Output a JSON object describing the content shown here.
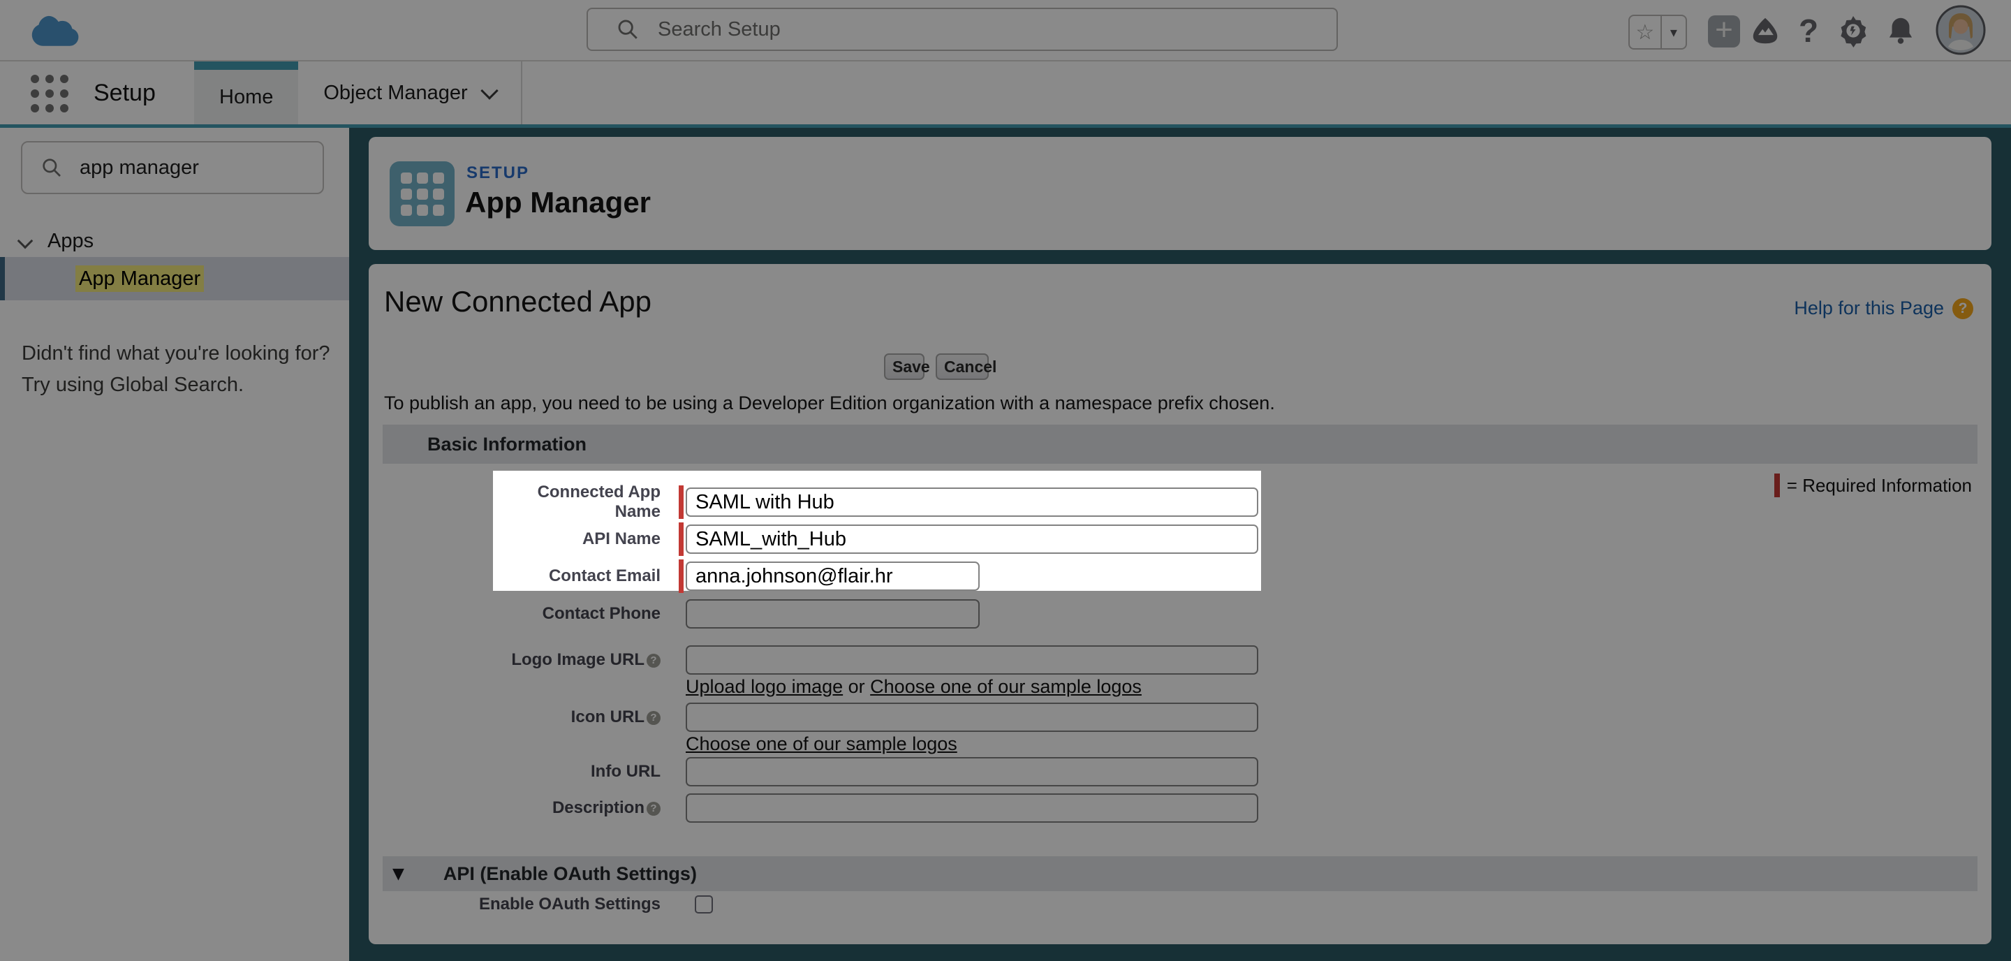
{
  "header": {
    "search_placeholder": "Search Setup",
    "icons": {
      "favorites_star_glyph": "☆",
      "favorites_caret_glyph": "▾",
      "add_glyph": "+",
      "help_glyph": "?",
      "trailhead": "guidance-center-icon",
      "setup_gear": "setup-gear-icon",
      "notifications": "bell-icon",
      "avatar": "user-photo"
    }
  },
  "nav": {
    "app_label": "Setup",
    "tabs": [
      {
        "label": "Home",
        "selected": true
      },
      {
        "label": "Object Manager",
        "selected": false
      }
    ]
  },
  "sidebar": {
    "search_value": "app manager",
    "tree": {
      "group": "Apps",
      "item": "App Manager"
    },
    "hint_line1": "Didn't find what you're looking for?",
    "hint_line2": "Try using Global Search."
  },
  "page_header": {
    "eyebrow": "SETUP",
    "title": "App Manager"
  },
  "form": {
    "title": "New Connected App",
    "help_link": "Help for this Page",
    "help_icon_glyph": "?",
    "save_label": "Save",
    "cancel_label": "Cancel",
    "publish_note": "To publish an app, you need to be using a Developer Edition organization with a namespace prefix chosen.",
    "section_basic": "Basic Information",
    "required_legend": "= Required Information",
    "section_api_glyph": "▼",
    "section_api": "API (Enable OAuth Settings)",
    "enable_oauth_label": "Enable OAuth Settings",
    "fields": {
      "connected_app_name": {
        "label": "Connected App Name",
        "value": "SAML with Hub"
      },
      "api_name": {
        "label": "API Name",
        "value": "SAML_with_Hub"
      },
      "contact_email": {
        "label": "Contact Email",
        "value": "anna.johnson@flair.hr"
      },
      "contact_phone": {
        "label": "Contact Phone",
        "value": ""
      },
      "logo_image_url": {
        "label": "Logo Image URL",
        "help": "?",
        "value": "",
        "link1": "Upload logo image",
        "or_text": " or ",
        "link2": "Choose one of our sample logos"
      },
      "icon_url": {
        "label": "Icon URL",
        "help": "?",
        "value": "",
        "link1": "Choose one of our sample logos"
      },
      "info_url": {
        "label": "Info URL",
        "value": ""
      },
      "description": {
        "label": "Description",
        "help": "?",
        "value": ""
      }
    }
  },
  "colors": {
    "accent_teal": "#439cb2",
    "brand_blue": "#4c94c9",
    "required_red": "#c23934",
    "link_blue": "#1b5fa8",
    "help_orange": "#f6a81d",
    "selected_row_bg": "#d8dde6",
    "highlight_yellow": "#f3e97e",
    "main_background": "#2b5964",
    "dim_overlay": "rgba(0,0,0,0.46)"
  }
}
